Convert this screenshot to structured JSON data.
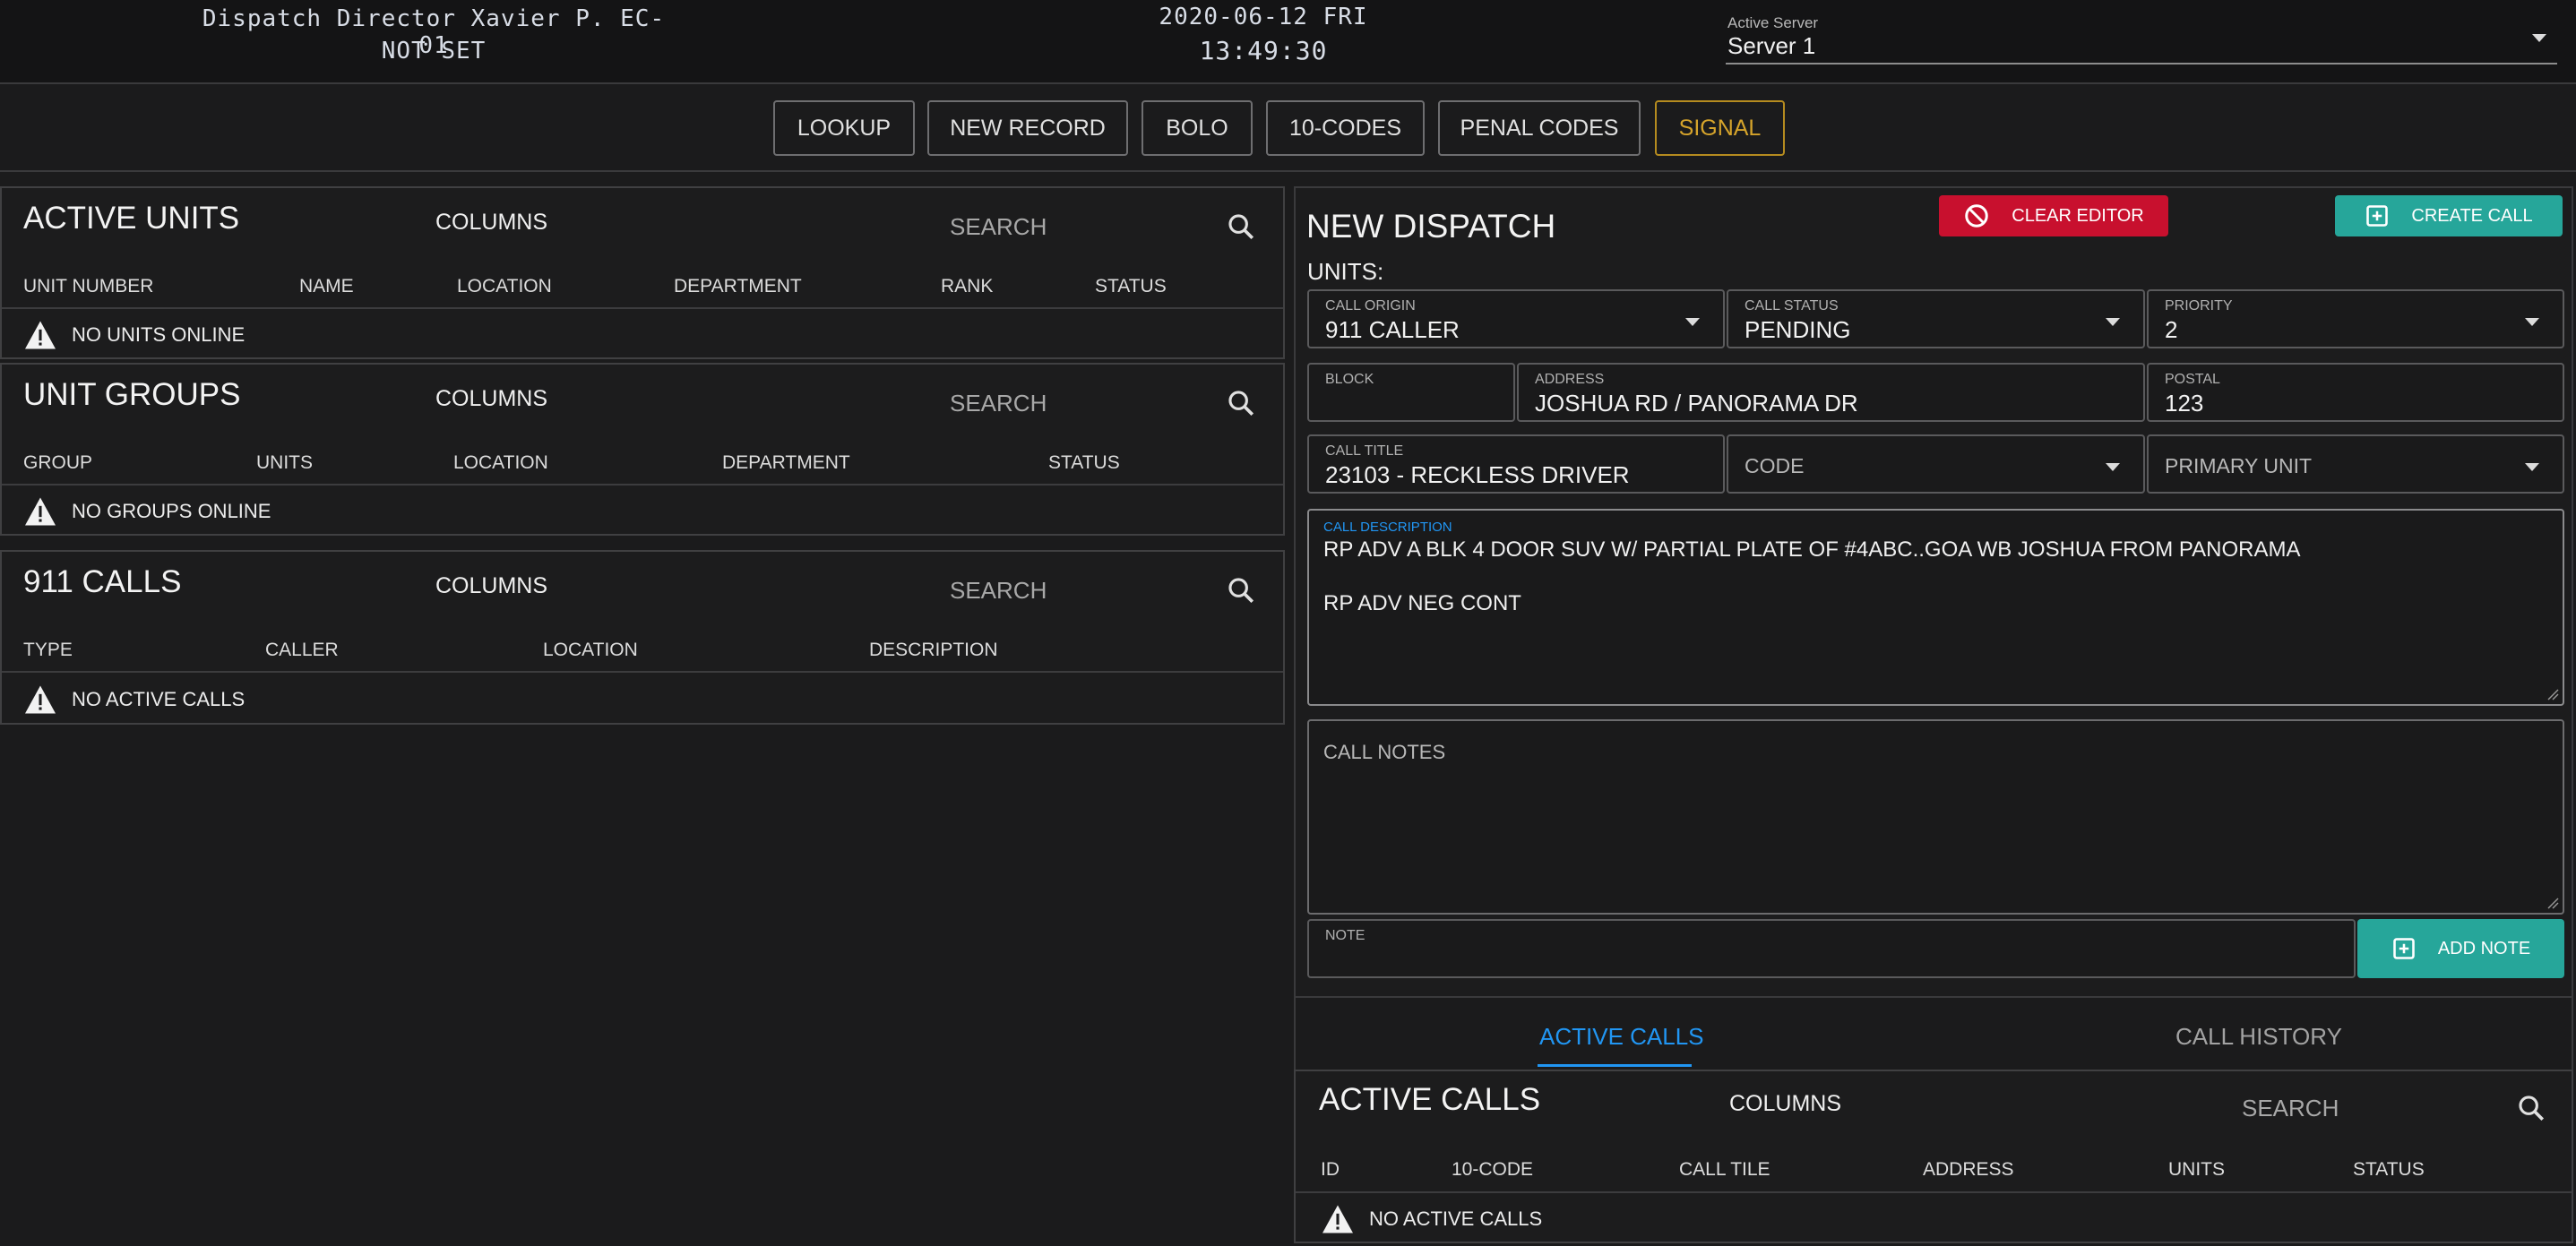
{
  "header": {
    "dispatcher_name": "Dispatch Director Xavier P. EC-01",
    "dispatcher_status": "NOT SET",
    "date": "2020-06-12 FRI",
    "time": "13:49:30",
    "server_label": "Active Server",
    "server_value": "Server 1"
  },
  "nav": {
    "lookup": "LOOKUP",
    "new_record": "NEW RECORD",
    "bolo": "BOLO",
    "ten_codes": "10-CODES",
    "penal_codes": "PENAL CODES",
    "signal": "SIGNAL"
  },
  "active_units": {
    "title": "ACTIVE UNITS",
    "columns_label": "COLUMNS",
    "search_placeholder": "SEARCH",
    "headers": [
      "UNIT NUMBER",
      "NAME",
      "LOCATION",
      "DEPARTMENT",
      "RANK",
      "STATUS"
    ],
    "empty": "NO UNITS ONLINE"
  },
  "unit_groups": {
    "title": "UNIT GROUPS",
    "columns_label": "COLUMNS",
    "search_placeholder": "SEARCH",
    "headers": [
      "GROUP",
      "UNITS",
      "LOCATION",
      "DEPARTMENT",
      "STATUS"
    ],
    "empty": "NO GROUPS ONLINE"
  },
  "calls_911": {
    "title": "911 CALLS",
    "columns_label": "COLUMNS",
    "search_placeholder": "SEARCH",
    "headers": [
      "TYPE",
      "CALLER",
      "LOCATION",
      "DESCRIPTION"
    ],
    "empty": "NO ACTIVE CALLS"
  },
  "dispatch": {
    "title": "NEW DISPATCH",
    "clear_button": "CLEAR EDITOR",
    "create_button": "CREATE CALL",
    "units_label": "UNITS:",
    "call_origin": {
      "label": "CALL ORIGIN",
      "value": "911 CALLER"
    },
    "call_status": {
      "label": "CALL STATUS",
      "value": "PENDING"
    },
    "priority": {
      "label": "PRIORITY",
      "value": "2"
    },
    "block": {
      "label": "BLOCK",
      "value": ""
    },
    "address": {
      "label": "ADDRESS",
      "value": "JOSHUA RD / PANORAMA DR"
    },
    "postal": {
      "label": "POSTAL",
      "value": "123"
    },
    "call_title": {
      "label": "CALL TITLE",
      "value": "23103 - RECKLESS DRIVER"
    },
    "code": {
      "placeholder": "CODE"
    },
    "primary_unit": {
      "placeholder": "PRIMARY UNIT"
    },
    "description": {
      "label": "CALL DESCRIPTION",
      "line1": "RP ADV A BLK 4 DOOR SUV W/ PARTIAL PLATE OF #4ABC..GOA WB JOSHUA FROM PANORAMA",
      "line2": "RP ADV NEG CONT"
    },
    "notes_placeholder": "CALL NOTES",
    "note_label": "NOTE",
    "add_note_button": "ADD NOTE"
  },
  "tabs": {
    "active_calls": "ACTIVE CALLS",
    "call_history": "CALL HISTORY"
  },
  "active_calls": {
    "title": "ACTIVE CALLS",
    "columns_label": "COLUMNS",
    "search_placeholder": "SEARCH",
    "headers": [
      "ID",
      "10-CODE",
      "CALL TILE",
      "ADDRESS",
      "UNITS",
      "STATUS"
    ],
    "empty": "NO ACTIVE CALLS"
  },
  "colors": {
    "accent_blue": "#2196f3",
    "teal": "#26a69a",
    "red": "#c8102e",
    "signal_gold": "#d6a42b"
  }
}
